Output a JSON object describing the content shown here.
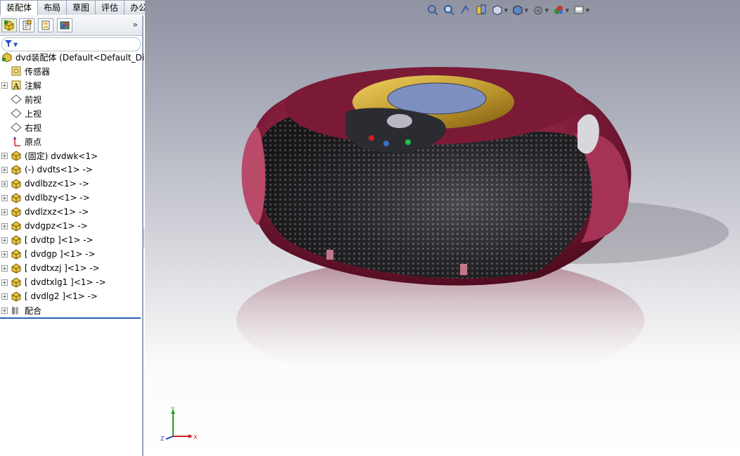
{
  "tabs": [
    {
      "label": "装配体",
      "active": true
    },
    {
      "label": "布局",
      "active": false
    },
    {
      "label": "草图",
      "active": false
    },
    {
      "label": "评估",
      "active": false
    },
    {
      "label": "办公室产品",
      "active": false
    }
  ],
  "panel": {
    "more_glyph": "»",
    "tabs": [
      "feature-manager-icon",
      "property-manager-icon",
      "configuration-manager-icon",
      "display-manager-icon"
    ]
  },
  "tree": {
    "root": "dvd装配体  (Default<Default_Dis",
    "items": [
      {
        "label": "传感器",
        "icon": "sensor-icon",
        "expandable": false
      },
      {
        "label": "注解",
        "icon": "annotation-icon",
        "expandable": true
      },
      {
        "label": "前视",
        "icon": "plane-icon",
        "expandable": false
      },
      {
        "label": "上视",
        "icon": "plane-icon",
        "expandable": false
      },
      {
        "label": "右视",
        "icon": "plane-icon",
        "expandable": false
      },
      {
        "label": "原点",
        "icon": "origin-icon",
        "expandable": false
      },
      {
        "label": "(固定) dvdwk<1>",
        "icon": "part-icon",
        "expandable": true
      },
      {
        "label": "(-) dvdts<1> ->",
        "icon": "part-icon",
        "expandable": true
      },
      {
        "label": "dvdlbzz<1> ->",
        "icon": "part-icon",
        "expandable": true
      },
      {
        "label": "dvdlbzy<1> ->",
        "icon": "part-icon",
        "expandable": true
      },
      {
        "label": "dvdlzxz<1> ->",
        "icon": "part-icon",
        "expandable": true
      },
      {
        "label": "dvdgpz<1> ->",
        "icon": "part-icon",
        "expandable": true
      },
      {
        "label": "[ dvdtp ]<1> ->",
        "icon": "part-icon",
        "expandable": true
      },
      {
        "label": "[ dvdgp ]<1> ->",
        "icon": "part-icon",
        "expandable": true
      },
      {
        "label": "[ dvdtxzj ]<1> ->",
        "icon": "part-icon",
        "expandable": true
      },
      {
        "label": "[ dvdtxlg1 ]<1> ->",
        "icon": "part-icon",
        "expandable": true
      },
      {
        "label": "[ dvdlg2 ]<1> ->",
        "icon": "part-icon",
        "expandable": true
      },
      {
        "label": "配合",
        "icon": "mates-icon",
        "expandable": true
      }
    ]
  },
  "toolbar": [
    "zoom-to-fit-icon",
    "zoom-area-icon",
    "previous-view-icon",
    "section-view-icon",
    "view-orientation-icon",
    "display-style-icon",
    "hide-show-icon",
    "appearance-icon",
    "scene-icon"
  ],
  "triad": {
    "x": "X",
    "y": "Y",
    "z": "Z"
  },
  "colors": {
    "body": "#7a1a35",
    "gold": "#c9a227",
    "speaker": "#2a2a2e",
    "accent": "#2c5fb8"
  }
}
